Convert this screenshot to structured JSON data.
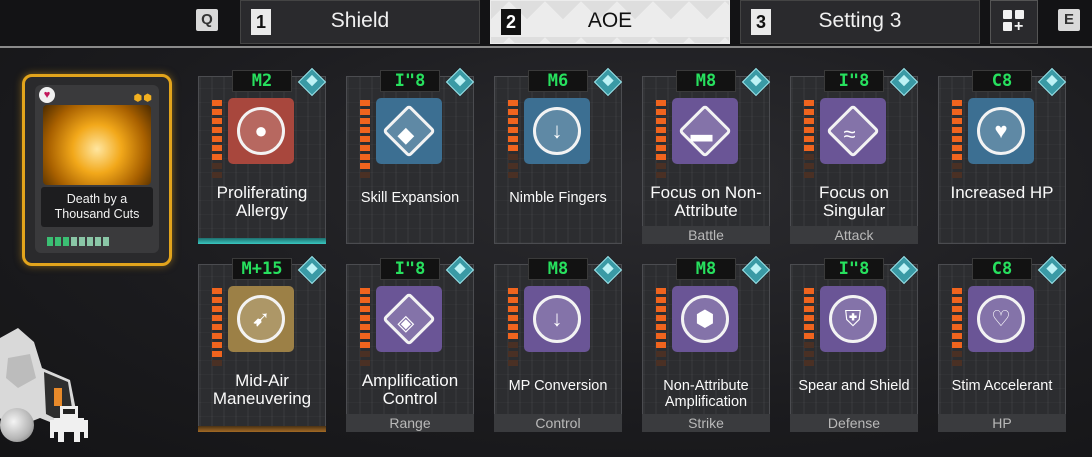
{
  "tabs": {
    "prev_key": "Q",
    "next_key": "E",
    "items": [
      {
        "num": "1",
        "label": "Shield",
        "active": false
      },
      {
        "num": "2",
        "label": "AOE",
        "active": true
      },
      {
        "num": "3",
        "label": "Setting 3",
        "active": false
      }
    ]
  },
  "featured": {
    "name": "Death by a Thousand Cuts",
    "accent": "#e2a41c"
  },
  "chips": [
    {
      "cost": "M2",
      "name": "Proliferating Allergy",
      "category": "",
      "icon": "cells-icon",
      "color": "#a8473d",
      "small": false
    },
    {
      "cost": "I\"8",
      "name": "Skill Expansion",
      "category": "",
      "icon": "diamond-burst-icon",
      "color": "#3c6f92",
      "small": true
    },
    {
      "cost": "M6",
      "name": "Nimble Fingers",
      "category": "",
      "icon": "gauge-arrow-icon",
      "color": "#3c6f92",
      "small": true
    },
    {
      "cost": "M8",
      "name": "Focus on Non-Attribute",
      "category": "Battle",
      "icon": "diamond-focus-icon",
      "color": "#6a5596",
      "small": false
    },
    {
      "cost": "I\"8",
      "name": "Focus on Singular",
      "category": "Attack",
      "icon": "diamond-wave-icon",
      "color": "#6a5596",
      "small": false
    },
    {
      "cost": "C8",
      "name": "Increased HP",
      "category": "",
      "icon": "heart-hands-icon",
      "color": "#3c6f92",
      "small": false
    },
    {
      "cost": "M+15",
      "name": "Mid-Air Maneuvering",
      "category": "",
      "icon": "grapple-icon",
      "color": "#9c8046",
      "small": false
    },
    {
      "cost": "I\"8",
      "name": "Amplification Control",
      "category": "Range",
      "icon": "diamond-spread-icon",
      "color": "#6a5596",
      "small": false
    },
    {
      "cost": "M8",
      "name": "MP Conversion",
      "category": "Control",
      "icon": "gauge-down-icon",
      "color": "#6a5596",
      "small": true
    },
    {
      "cost": "M8",
      "name": "Non-Attribute Amplification",
      "category": "Strike",
      "icon": "hexagon-arrows-icon",
      "color": "#6a5596",
      "small": true
    },
    {
      "cost": "I\"8",
      "name": "Spear and Shield",
      "category": "Defense",
      "icon": "shield-spear-icon",
      "color": "#6a5596",
      "small": true
    },
    {
      "cost": "C8",
      "name": "Stim Accelerant",
      "category": "HP",
      "icon": "heart-outline-icon",
      "color": "#6a5596",
      "small": true
    }
  ]
}
